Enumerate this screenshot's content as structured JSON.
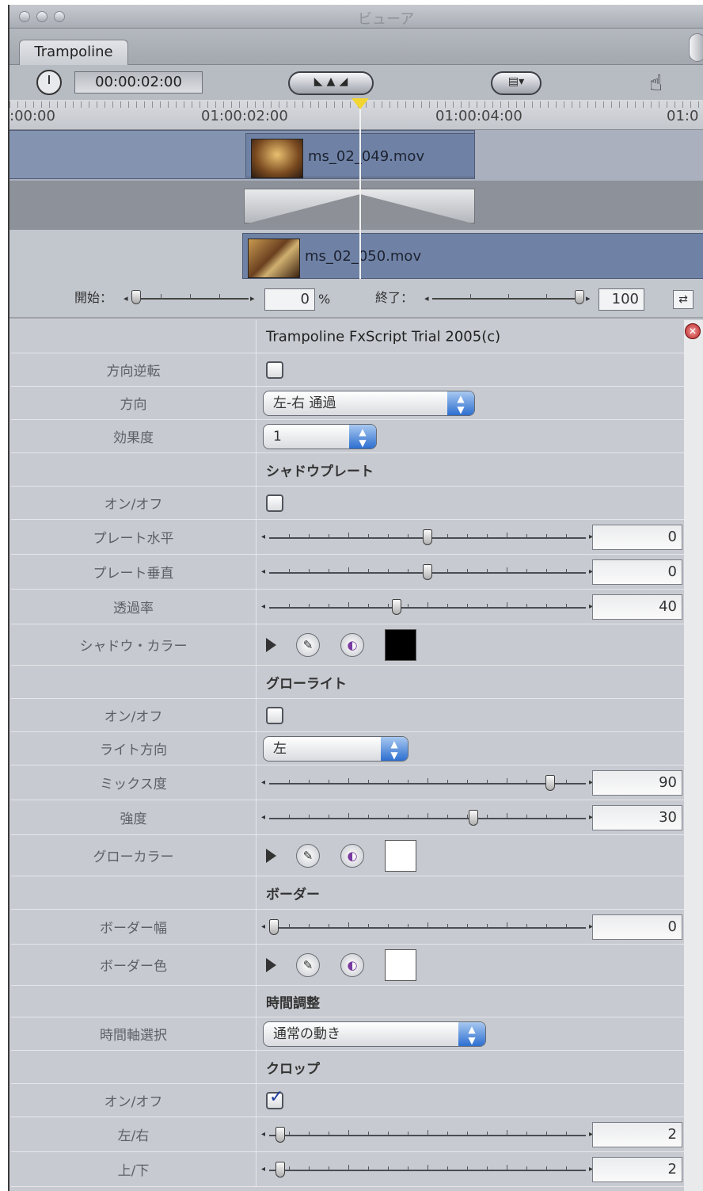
{
  "window": {
    "title": "ビューア"
  },
  "tab": {
    "label": "Trampoline"
  },
  "toolbar": {
    "timecode": "00:00:02:00",
    "view_icon": "▤▾"
  },
  "ruler": {
    "labels": [
      ":00:00",
      "01:00:02:00",
      "01:00:04:00",
      "01:0"
    ]
  },
  "clips": [
    {
      "name": "ms_02_049.mov"
    },
    {
      "name": "ms_02_050.mov"
    }
  ],
  "start_end": {
    "start_label": "開始：",
    "start_value": "0",
    "percent": "%",
    "end_label": "終了：",
    "end_value": "100"
  },
  "params": {
    "title": "Trampoline  FxScript Trial 2005(c)",
    "reverse_label": "方向逆転",
    "direction_label": "方向",
    "direction_value": "左-右 通過",
    "effect_label": "効果度",
    "effect_value": "1",
    "shadow_header": "シャドウプレート",
    "shadow_onoff_label": "オン/オフ",
    "plate_h_label": "プレート水平",
    "plate_h_value": "0",
    "plate_v_label": "プレート垂直",
    "plate_v_value": "0",
    "opacity_label": "透過率",
    "opacity_value": "40",
    "shadow_color_label": "シャドウ・カラー",
    "glow_header": "グローライト",
    "glow_onoff_label": "オン/オフ",
    "light_dir_label": "ライト方向",
    "light_dir_value": "左",
    "mix_label": "ミックス度",
    "mix_value": "90",
    "intensity_label": "強度",
    "intensity_value": "30",
    "glow_color_label": "グローカラー",
    "border_header": "ボーダー",
    "border_width_label": "ボーダー幅",
    "border_width_value": "0",
    "border_color_label": "ボーダー色",
    "time_header": "時間調整",
    "time_axis_label": "時間軸選択",
    "time_axis_value": "通常の動き",
    "crop_header": "クロップ",
    "crop_onoff_label": "オン/オフ",
    "lr_label": "左/右",
    "lr_value": "2",
    "tb_label": "上/下",
    "tb_value": "2"
  },
  "colors": {
    "shadow_color": "#000000",
    "glow_color": "#ffffff",
    "border_color": "#ffffff"
  },
  "levels": {
    "start": 0,
    "end": 100,
    "plate_h": 0,
    "plate_v": 0,
    "opacity": 40,
    "mix": 90,
    "intensity": 30,
    "border_width": 0,
    "crop_lr": 2,
    "crop_tb": 2
  }
}
